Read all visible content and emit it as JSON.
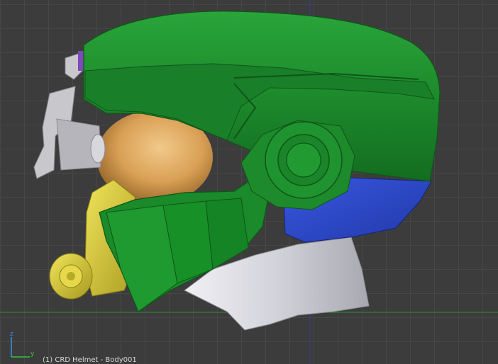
{
  "viewport": {
    "axis_triad": {
      "z_label": "z",
      "y_label": "y"
    },
    "status_text": "(1) CRD Helmet - Body001"
  },
  "colors": {
    "background": "#3c3c3c",
    "grid_line": "#474747",
    "ground_line": "#2f8f2f",
    "vertical_axis_line": "#3a3aa8",
    "shell_green": "#1d8a2c",
    "visor_gold": "#d9a055",
    "side_blue": "#2d4ac8",
    "neck_silver": "#d4d4dc",
    "mechanism_gray": "#c8c8cc",
    "breather_yellow": "#d8cc3a",
    "accent_purple": "#7b4bb8",
    "axis_z": "#3a8ee0",
    "axis_y": "#39c23f"
  }
}
